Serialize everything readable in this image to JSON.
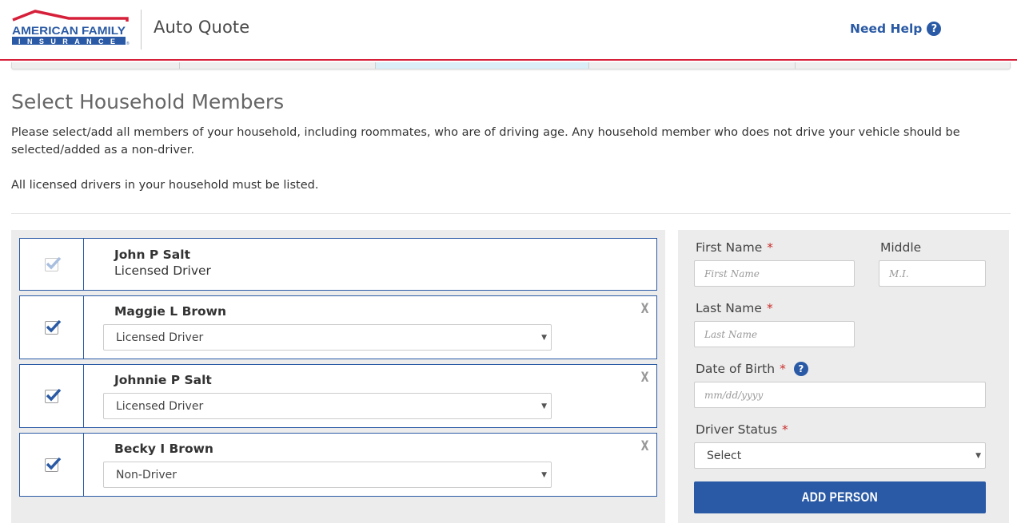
{
  "header": {
    "brand_line1": "AMERICAN FAMILY",
    "brand_line2": "INSURANCE",
    "app_title": "Auto Quote",
    "need_help_label": "Need Help",
    "help_icon": "?"
  },
  "colors": {
    "brand_blue": "#2a5aa5",
    "brand_red": "#d6203a",
    "required_red": "#c9302c",
    "panel_gray": "#ececec",
    "progress_active": "#d9eef7"
  },
  "progress": {
    "steps": 5,
    "active_step": 3
  },
  "page": {
    "title": "Select Household Members",
    "intro": "Please select/add all members of your household, including roommates, who are of driving age. Any household member who does not drive your vehicle should be selected/added as a non-driver.",
    "note": "All licensed drivers in your household must be listed."
  },
  "members": [
    {
      "name": "John P Salt",
      "status": "Licensed Driver",
      "checked": true,
      "locked": true
    },
    {
      "name": "Maggie L Brown",
      "status": "Licensed Driver",
      "checked": true,
      "locked": false,
      "remove_label": "X"
    },
    {
      "name": "Johnnie P Salt",
      "status": "Licensed Driver",
      "checked": true,
      "locked": false,
      "remove_label": "X"
    },
    {
      "name": "Becky I Brown",
      "status": "Non-Driver",
      "checked": true,
      "locked": false,
      "remove_label": "X"
    }
  ],
  "form": {
    "first_name_label": "First Name",
    "first_name_placeholder": "First Name",
    "middle_label": "Middle",
    "middle_placeholder": "M.I.",
    "last_name_label": "Last Name",
    "last_name_placeholder": "Last Name",
    "dob_label": "Date of Birth",
    "dob_placeholder": "mm/dd/yyyy",
    "driver_status_label": "Driver Status",
    "driver_status_value": "Select",
    "required_mark": "*",
    "add_button_label": "ADD PERSON"
  }
}
